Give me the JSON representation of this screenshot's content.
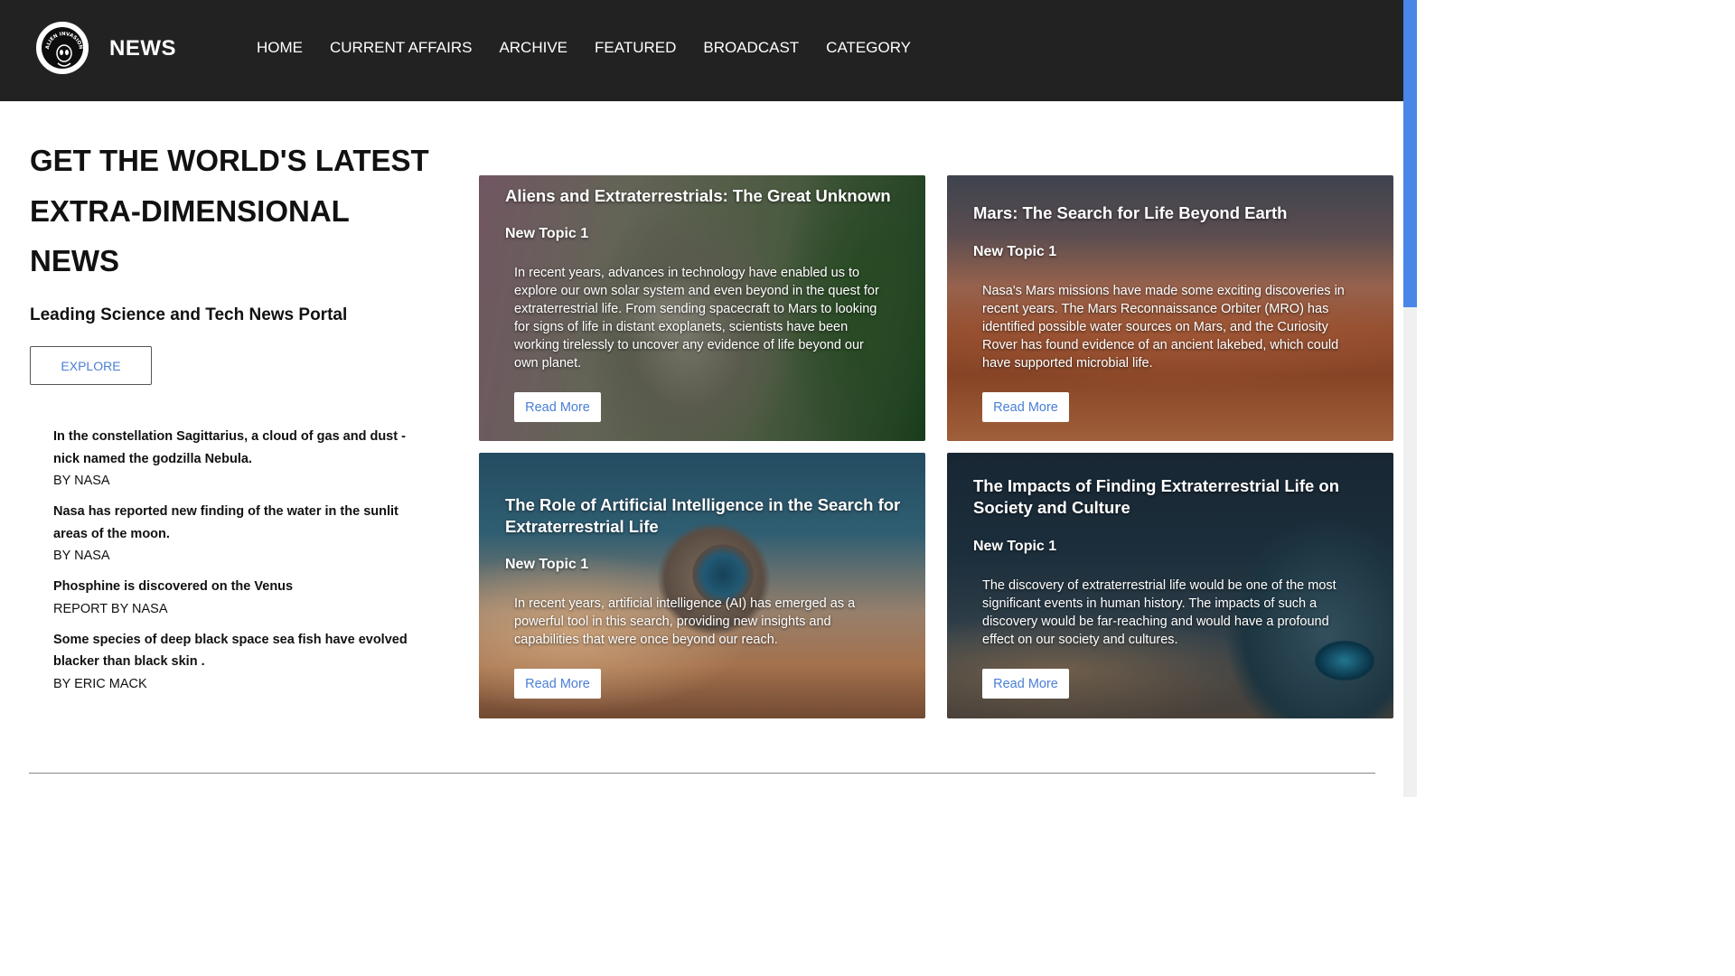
{
  "header": {
    "brand": "NEWS",
    "logo_text": "ALIEN INVASION",
    "nav": [
      "HOME",
      "CURRENT AFFAIRS",
      "ARCHIVE",
      "FEATURED",
      "BROADCAST",
      "CATEGORY"
    ]
  },
  "hero": {
    "title_lines": [
      "GET THE WORLD'S LATEST",
      "EXTRA-DIMENSIONAL",
      "NEWS"
    ],
    "subtitle": "Leading Science and Tech News Portal",
    "explore_label": "EXPLORE"
  },
  "headlines": [
    {
      "title": "In the constellation Sagittarius, a cloud of gas and dust - nick named the godzilla Nebula.",
      "byline": "BY NASA"
    },
    {
      "title": "Nasa has reported new finding of the water in the sunlit areas of the moon.",
      "byline": "BY NASA"
    },
    {
      "title": "Phosphine is discovered on the Venus",
      "byline": "REPORT BY NASA"
    },
    {
      "title": "Some species of deep black space sea fish have evolved blacker than black skin .",
      "byline": "BY ERIC MACK"
    }
  ],
  "cards": [
    {
      "title": "Aliens and Extraterrestrials: The Great Unknown",
      "topic": "New Topic 1",
      "text": "In recent years, advances in technology have enabled us to explore our own solar system and even beyond in the quest for extraterrestrial life. From sending spacecraft to Mars to looking for signs of life in distant exoplanets, scientists have been working tirelessly to uncover any evidence of life beyond our own planet.",
      "button": "Read More"
    },
    {
      "title": "Mars: The Search for Life Beyond Earth",
      "topic": "New Topic 1",
      "text": "Nasa's Mars missions have made some exciting discoveries in recent years. The Mars Reconnaissance Orbiter (MRO) has identified possible water sources on Mars, and the Curiosity Rover has found evidence of an ancient lakebed, which could have supported microbial life.",
      "button": "Read More"
    },
    {
      "title": "The Role of Artificial Intelligence in the Search for Extraterrestrial Life",
      "topic": "New Topic 1",
      "text": "In recent years, artificial intelligence (AI) has emerged as a powerful tool in this search, providing new insights and capabilities that were once beyond our reach.",
      "button": "Read More"
    },
    {
      "title": "The Impacts of Finding Extraterrestrial Life on Society and Culture",
      "topic": "New Topic 1",
      "text": "The discovery of extraterrestrial life would be one of the most significant events in human history. The impacts of such a discovery would be far-reaching and would have a profound effect on our society and cultures.",
      "button": "Read More"
    }
  ],
  "colors": {
    "header_bg": "#222222",
    "accent": "#4a7fd6",
    "scrollbar": "#4a86e8"
  }
}
